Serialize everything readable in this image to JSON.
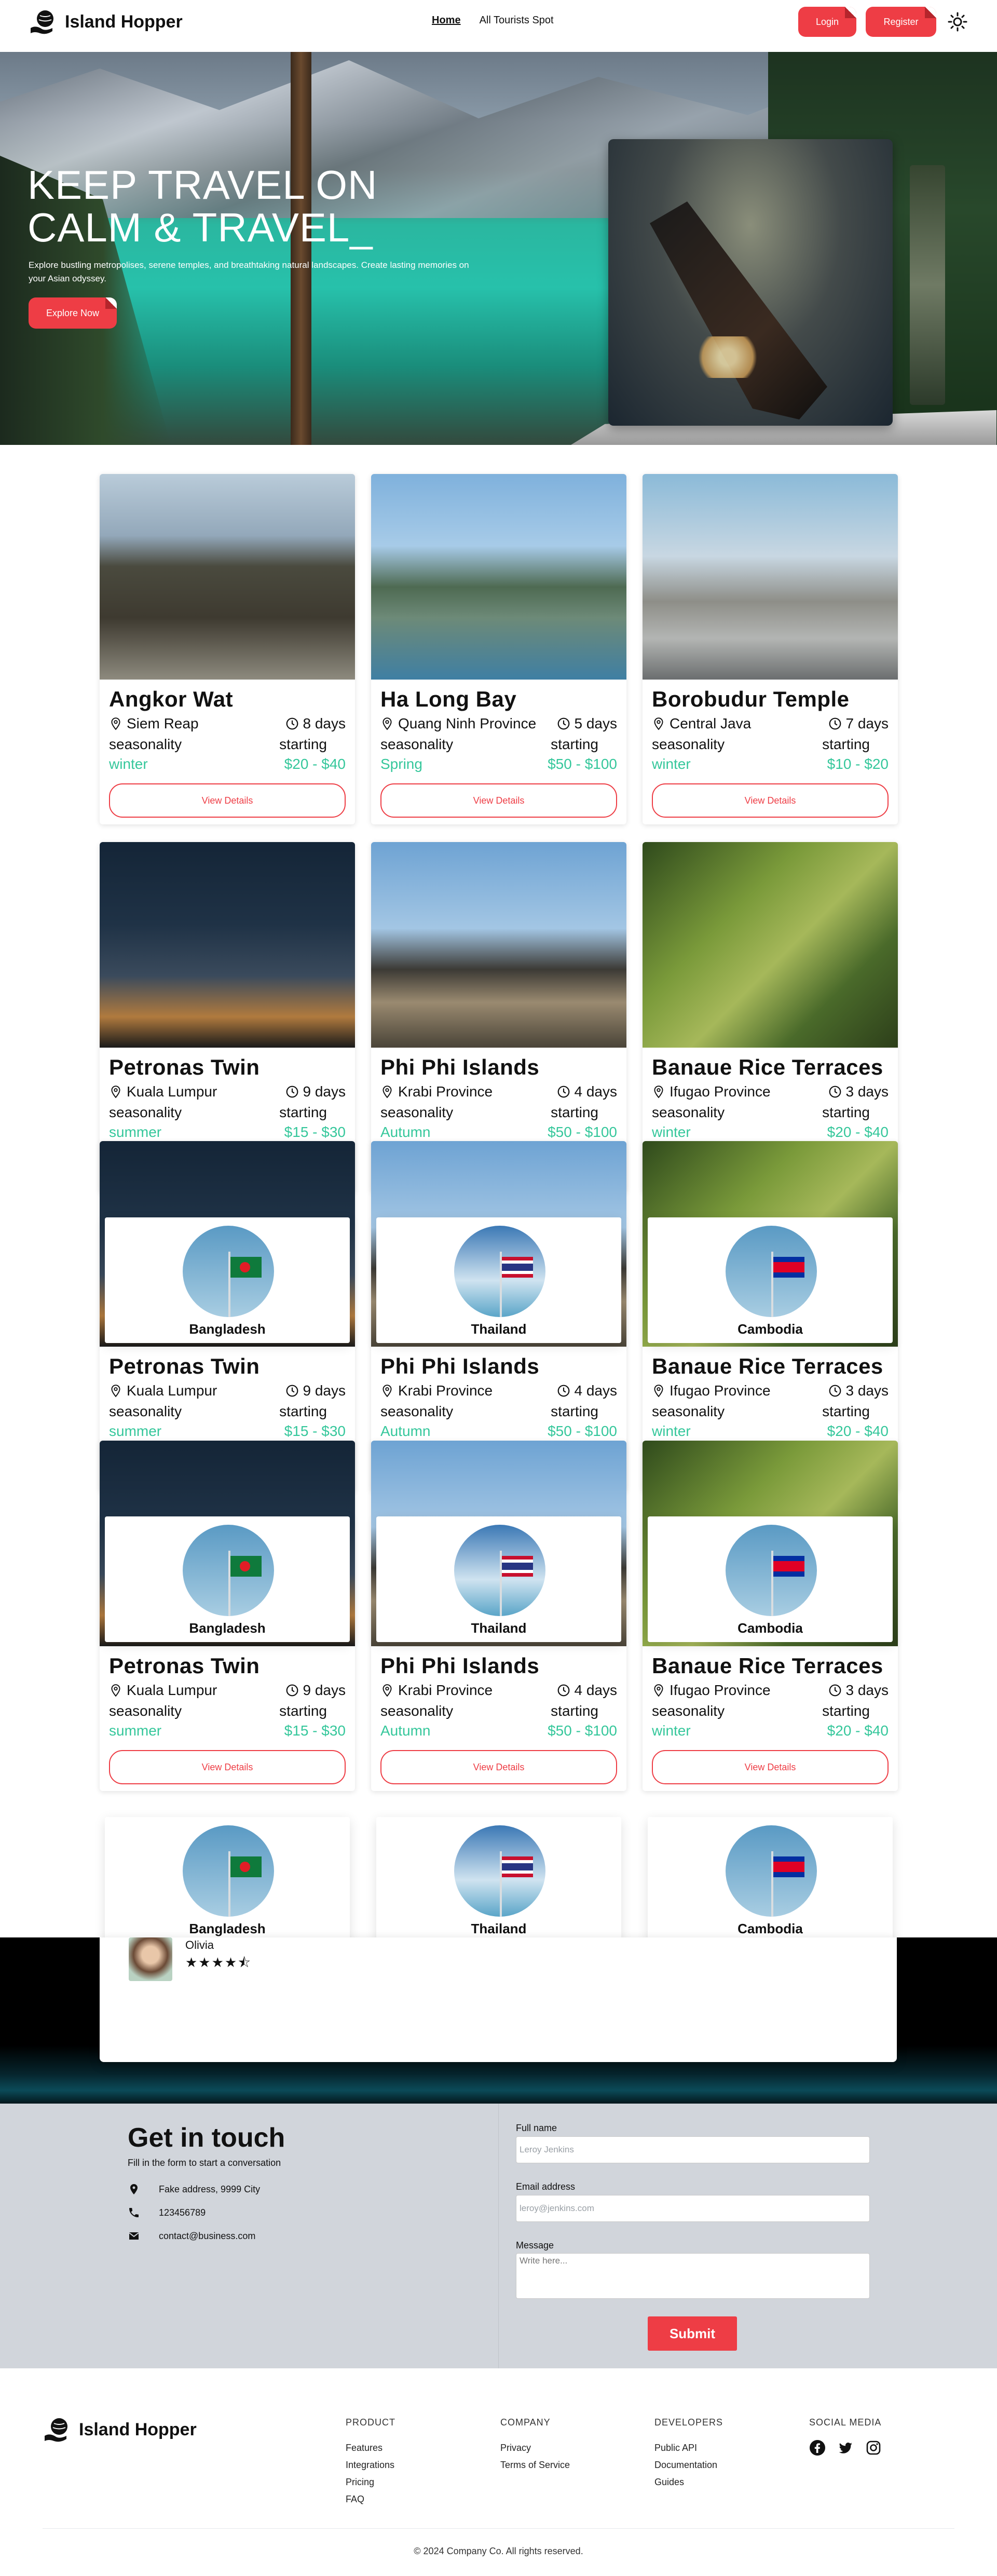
{
  "header": {
    "brand": "Island Hopper",
    "nav": [
      {
        "label": "Home"
      },
      {
        "label": "All Tourists Spot"
      }
    ],
    "login": "Login",
    "register": "Register"
  },
  "hero": {
    "title_line1": "KEEP TRAVEL ON",
    "title_line2": "CALM & TRAVEL_",
    "subtitle": "Explore bustling metropolises, serene temples, and breathtaking natural landscapes. Create lasting memories on your Asian odyssey.",
    "cta": "Explore Now"
  },
  "cards": [
    {
      "title": "Angkor Wat",
      "location": "Siem Reap",
      "days": "8 days",
      "season_label": "seasonality",
      "price_label": "starting",
      "season": "winter",
      "price": "$20 - $40",
      "cta": "View Details"
    },
    {
      "title": "Ha Long Bay",
      "location": "Quang Ninh Province",
      "days": "5 days",
      "season_label": "seasonality",
      "price_label": "starting",
      "season": "Spring",
      "price": "$50 - $100",
      "cta": "View Details"
    },
    {
      "title": "Borobudur Temple",
      "location": "Central Java",
      "days": "7 days",
      "season_label": "seasonality",
      "price_label": "starting",
      "season": "winter",
      "price": "$10 - $20",
      "cta": "View Details"
    },
    {
      "title": "Petronas Twin",
      "location": "Kuala Lumpur",
      "days": "9 days",
      "season_label": "seasonality",
      "price_label": "starting",
      "season": "summer",
      "price": "$15 - $30",
      "cta": "View Details"
    },
    {
      "title": "Phi Phi Islands",
      "location": "Krabi Province",
      "days": "4 days",
      "season_label": "seasonality",
      "price_label": "starting",
      "season": "Autumn",
      "price": "$50 - $100",
      "cta": "View Details"
    },
    {
      "title": "Banaue Rice Terraces",
      "location": "Ifugao Province",
      "days": "3 days",
      "season_label": "seasonality",
      "price_label": "starting",
      "season": "winter",
      "price": "$20 - $40",
      "cta": "View Details"
    }
  ],
  "countries": [
    {
      "name": "Bangladesh"
    },
    {
      "name": "Thailand"
    },
    {
      "name": "Cambodia"
    }
  ],
  "testimonial": {
    "name": "Olivia",
    "stars": "★★★★⯪"
  },
  "contact": {
    "title": "Get in touch",
    "subtitle": "Fill in the form to start a conversation",
    "address": "Fake address, 9999 City",
    "phone": "123456789",
    "email": "contact@business.com",
    "name_label": "Full name",
    "name_placeholder": "Leroy Jenkins",
    "email_label": "Email address",
    "email_placeholder": "leroy@jenkins.com",
    "message_label": "Message",
    "message_placeholder": "Write here...",
    "submit": "Submit"
  },
  "footer": {
    "brand": "Island Hopper",
    "product": {
      "heading": "PRODUCT",
      "links": [
        "Features",
        "Integrations",
        "Pricing",
        "FAQ"
      ]
    },
    "company": {
      "heading": "COMPANY",
      "links": [
        "Privacy",
        "Terms of Service"
      ]
    },
    "developers": {
      "heading": "DEVELOPERS",
      "links": [
        "Public API",
        "Documentation",
        "Guides"
      ]
    },
    "social": {
      "heading": "SOCIAL MEDIA",
      "icons": [
        "facebook-icon",
        "twitter-icon",
        "instagram-icon"
      ]
    },
    "copyright": "© 2024 Company Co. All rights reserved."
  },
  "colors": {
    "accent": "#ee3d45",
    "season_green": "#35c79b",
    "contact_bg": "#d1d5db"
  }
}
